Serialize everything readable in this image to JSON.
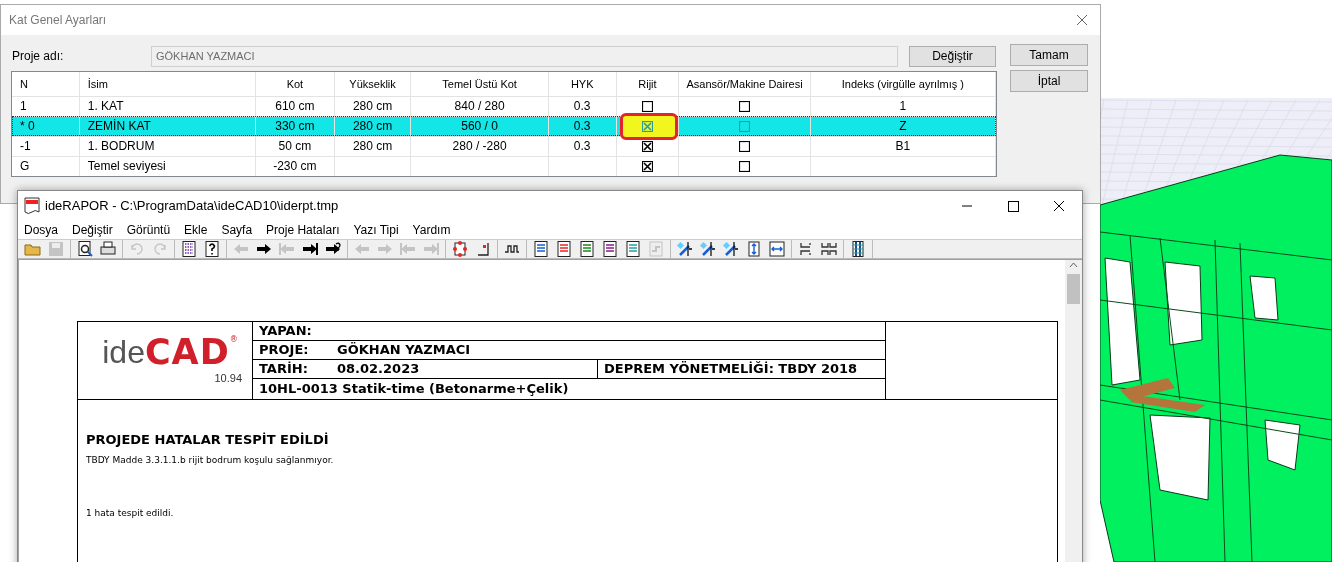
{
  "dialog": {
    "title": "Kat Genel Ayarları",
    "project_label": "Proje adı:",
    "project_name": "GÖKHAN YAZMACI",
    "change_button": "Değiştir",
    "ok_button": "Tamam",
    "cancel_button": "İptal",
    "table": {
      "columns": [
        "N",
        "İsim",
        "Kot",
        "Yükseklik",
        "Temel Üstü Kot",
        "HYK",
        "Rijit",
        "Asansör/Makine Dairesi",
        "Indeks (virgülle ayrılmış )"
      ],
      "rows": [
        {
          "n": "1",
          "name": "1. KAT",
          "kot": "610 cm",
          "height": "280 cm",
          "foundation_top": "840 / 280",
          "hyk": "0.3",
          "rigid": false,
          "elevator": false,
          "index": "1",
          "selected": false,
          "highlighted": false
        },
        {
          "n": "* 0",
          "name": "ZEMİN KAT",
          "kot": "330 cm",
          "height": "280 cm",
          "foundation_top": "560 / 0",
          "hyk": "0.3",
          "rigid": true,
          "elevator": false,
          "index": "Z",
          "selected": true,
          "highlighted": true
        },
        {
          "n": "-1",
          "name": "1. BODRUM",
          "kot": "50 cm",
          "height": "280 cm",
          "foundation_top": "280 / -280",
          "hyk": "0.3",
          "rigid": true,
          "elevator": false,
          "index": "B1",
          "selected": false,
          "highlighted": false
        },
        {
          "n": "G",
          "name": "Temel seviyesi",
          "kot": "-230 cm",
          "rigid": true,
          "elevator": false,
          "selected": false,
          "highlighted": false
        }
      ]
    }
  },
  "report_window": {
    "title": "ideRAPOR - C:\\ProgramData\\ideCAD10\\iderpt.tmp",
    "menu": [
      "Dosya",
      "Değiştir",
      "Görüntü",
      "Ekle",
      "Sayfa",
      "Proje Hataları",
      "Yazı Tipi",
      "Yardım"
    ],
    "document": {
      "logo": {
        "ide": "ide",
        "cad": "CAD",
        "mark": "®",
        "version": "10.94"
      },
      "header": {
        "yapan_label": "YAPAN:",
        "proje_label": "PROJE:",
        "proje": "GÖKHAN YAZMACI",
        "tarih_label": "TARİH:",
        "tarih": "08.02.2023",
        "regulation": "DEPREM YÖNETMELİĞİ: TBDY 2018",
        "program": "10HL-0013 Statik-time (Betonarme+Çelik)"
      },
      "heading": "PROJEDE HATALAR TESPİT EDİLDİ",
      "lines": [
        "TBDY Madde 3.3.1.1.b rijit bodrum koşulu sağlanmıyor.",
        "1 hata tespit edildi."
      ]
    }
  }
}
